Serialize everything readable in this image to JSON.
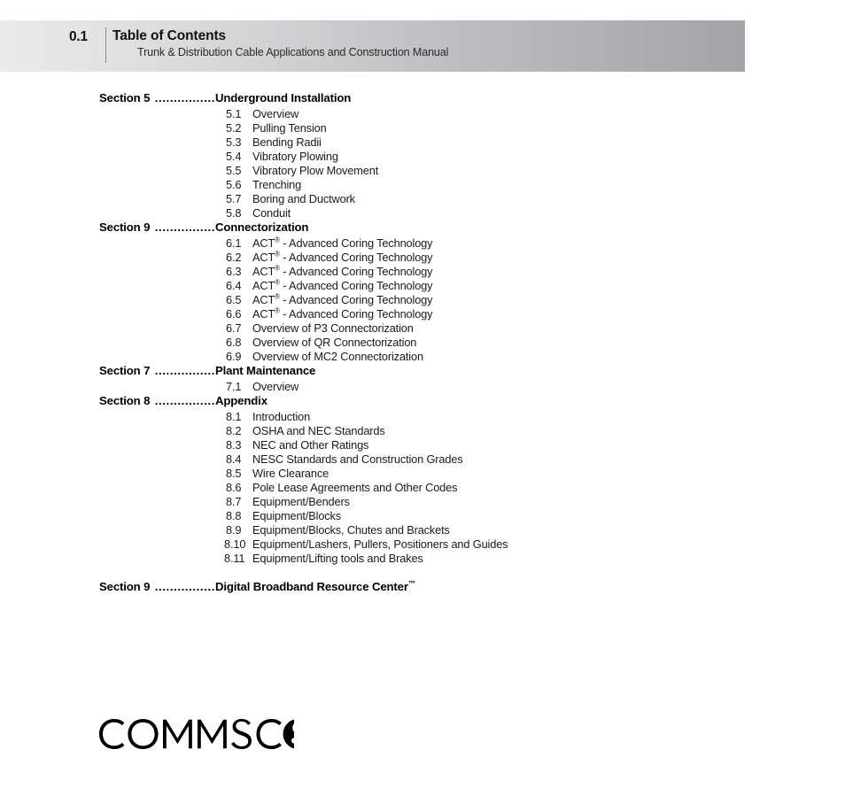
{
  "header": {
    "number": "0.1",
    "title": "Table of Contents",
    "subtitle": "Trunk & Distribution Cable Applications and Construction Manual",
    "gradient_start_color": "#eaeaeb",
    "gradient_end_color": "#a2a4a8"
  },
  "toc": {
    "leader_dots": "................",
    "sections": [
      {
        "label": "Section 5",
        "title": "Underground Installation",
        "items": [
          {
            "num": "5.1",
            "text": "Overview"
          },
          {
            "num": "5.2",
            "text": "Pulling Tension"
          },
          {
            "num": "5.3",
            "text": "Bending Radii"
          },
          {
            "num": "5.4",
            "text": "Vibratory Plowing"
          },
          {
            "num": "5.5",
            "text": "Vibratory Plow Movement"
          },
          {
            "num": "5.6",
            "text": "Trenching"
          },
          {
            "num": "5.7",
            "text": "Boring and Ductwork"
          },
          {
            "num": "5.8",
            "text": "Conduit"
          }
        ]
      },
      {
        "label": "Section 9",
        "title": "Connectorization",
        "items": [
          {
            "num": "6.1",
            "text": "ACT® - Advanced Coring Technology"
          },
          {
            "num": "6.2",
            "text": "ACT® - Advanced Coring Technology"
          },
          {
            "num": "6.3",
            "text": "ACT® - Advanced Coring Technology"
          },
          {
            "num": "6.4",
            "text": "ACT® - Advanced Coring Technology"
          },
          {
            "num": "6.5",
            "text": "ACT® - Advanced Coring Technology"
          },
          {
            "num": "6.6",
            "text": "ACT® - Advanced Coring Technology"
          },
          {
            "num": "6.7",
            "text": "Overview of P3 Connectorization"
          },
          {
            "num": "6.8",
            "text": "Overview of QR Connectorization"
          },
          {
            "num": "6.9",
            "text": "Overview of MC2 Connectorization"
          }
        ]
      },
      {
        "label": "Section 7",
        "title": "Plant Maintenance",
        "items": [
          {
            "num": "7.1",
            "text": "Overview"
          }
        ]
      },
      {
        "label": "Section 8",
        "title": "Appendix",
        "items": [
          {
            "num": "8.1",
            "text": "Introduction"
          },
          {
            "num": "8.2",
            "text": "OSHA and NEC Standards"
          },
          {
            "num": "8.3",
            "text": "NEC and Other Ratings"
          },
          {
            "num": "8.4",
            "text": "NESC Standards and Construction Grades"
          },
          {
            "num": "8.5",
            "text": "Wire Clearance"
          },
          {
            "num": "8.6",
            "text": "Pole Lease Agreements and Other Codes"
          },
          {
            "num": "8.7",
            "text": "Equipment/Benders"
          },
          {
            "num": "8.8",
            "text": "Equipment/Blocks"
          },
          {
            "num": "8.9",
            "text": "Equipment/Blocks, Chutes and Brackets"
          },
          {
            "num": "8.10",
            "text": "Equipment/Lashers, Pullers, Positioners and Guides"
          },
          {
            "num": "8.11",
            "text": "Equipment/Lifting tools and Brakes"
          }
        ]
      },
      {
        "label": "Section 9",
        "title": "Digital Broadband Resource Center™",
        "items": []
      }
    ]
  },
  "logo": {
    "text": "COMMSCOPE",
    "trademark": "®",
    "name": "commscope-logo"
  }
}
